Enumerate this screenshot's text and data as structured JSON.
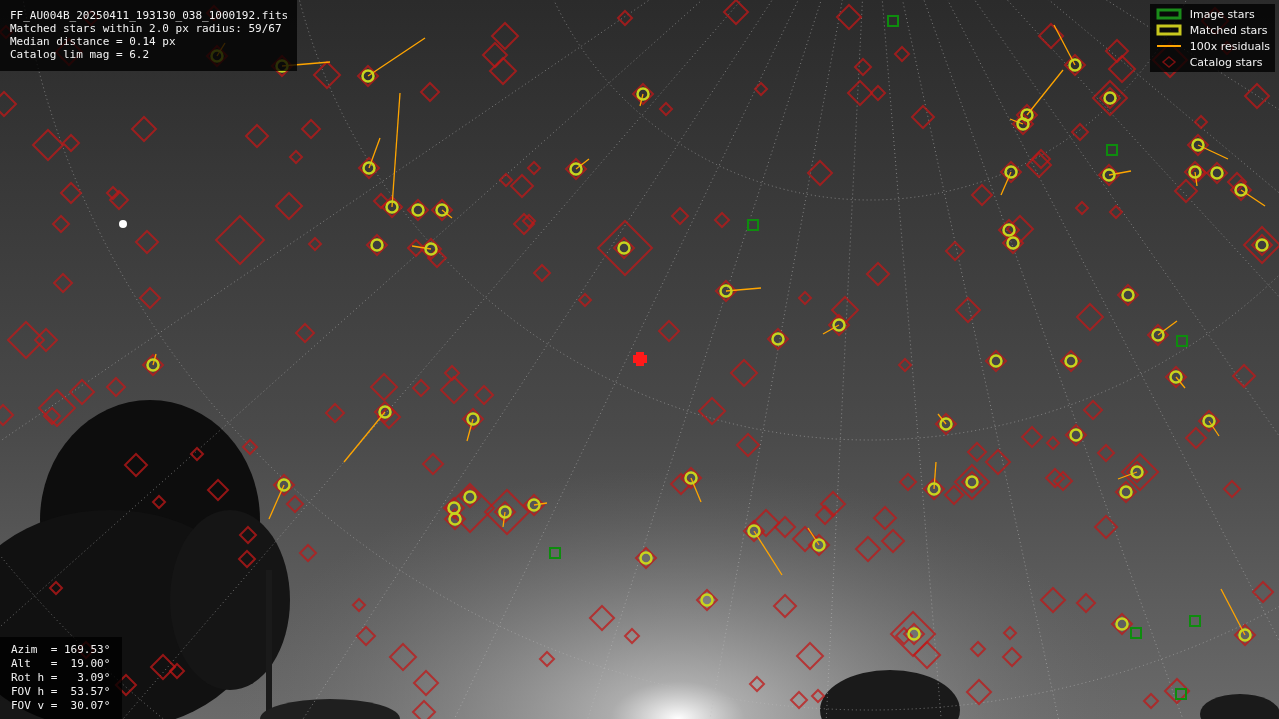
{
  "info": {
    "lines": [
      "FF_AU004B_20250411_193130_038_1000192.fits",
      "Matched stars within 2.0 px radius: 59/67",
      "Median distance = 0.14 px",
      "Catalog lim mag = 6.2"
    ]
  },
  "legend": [
    {
      "label": "Image stars",
      "kind": "box",
      "color": "#1a8c1a"
    },
    {
      "label": "Matched stars",
      "kind": "box",
      "color": "#c8c81e"
    },
    {
      "label": "100x residuals",
      "kind": "line",
      "color": "#ffa500"
    },
    {
      "label": "Catalog stars",
      "kind": "diamond",
      "color": "#7a1010"
    }
  ],
  "pointing": {
    "lines": [
      "Azim  = 169.53°",
      "Alt   =  19.00°",
      "Rot h =   3.09°",
      "FOV h =  53.57°",
      "FOV v =  30.07°"
    ]
  }
}
